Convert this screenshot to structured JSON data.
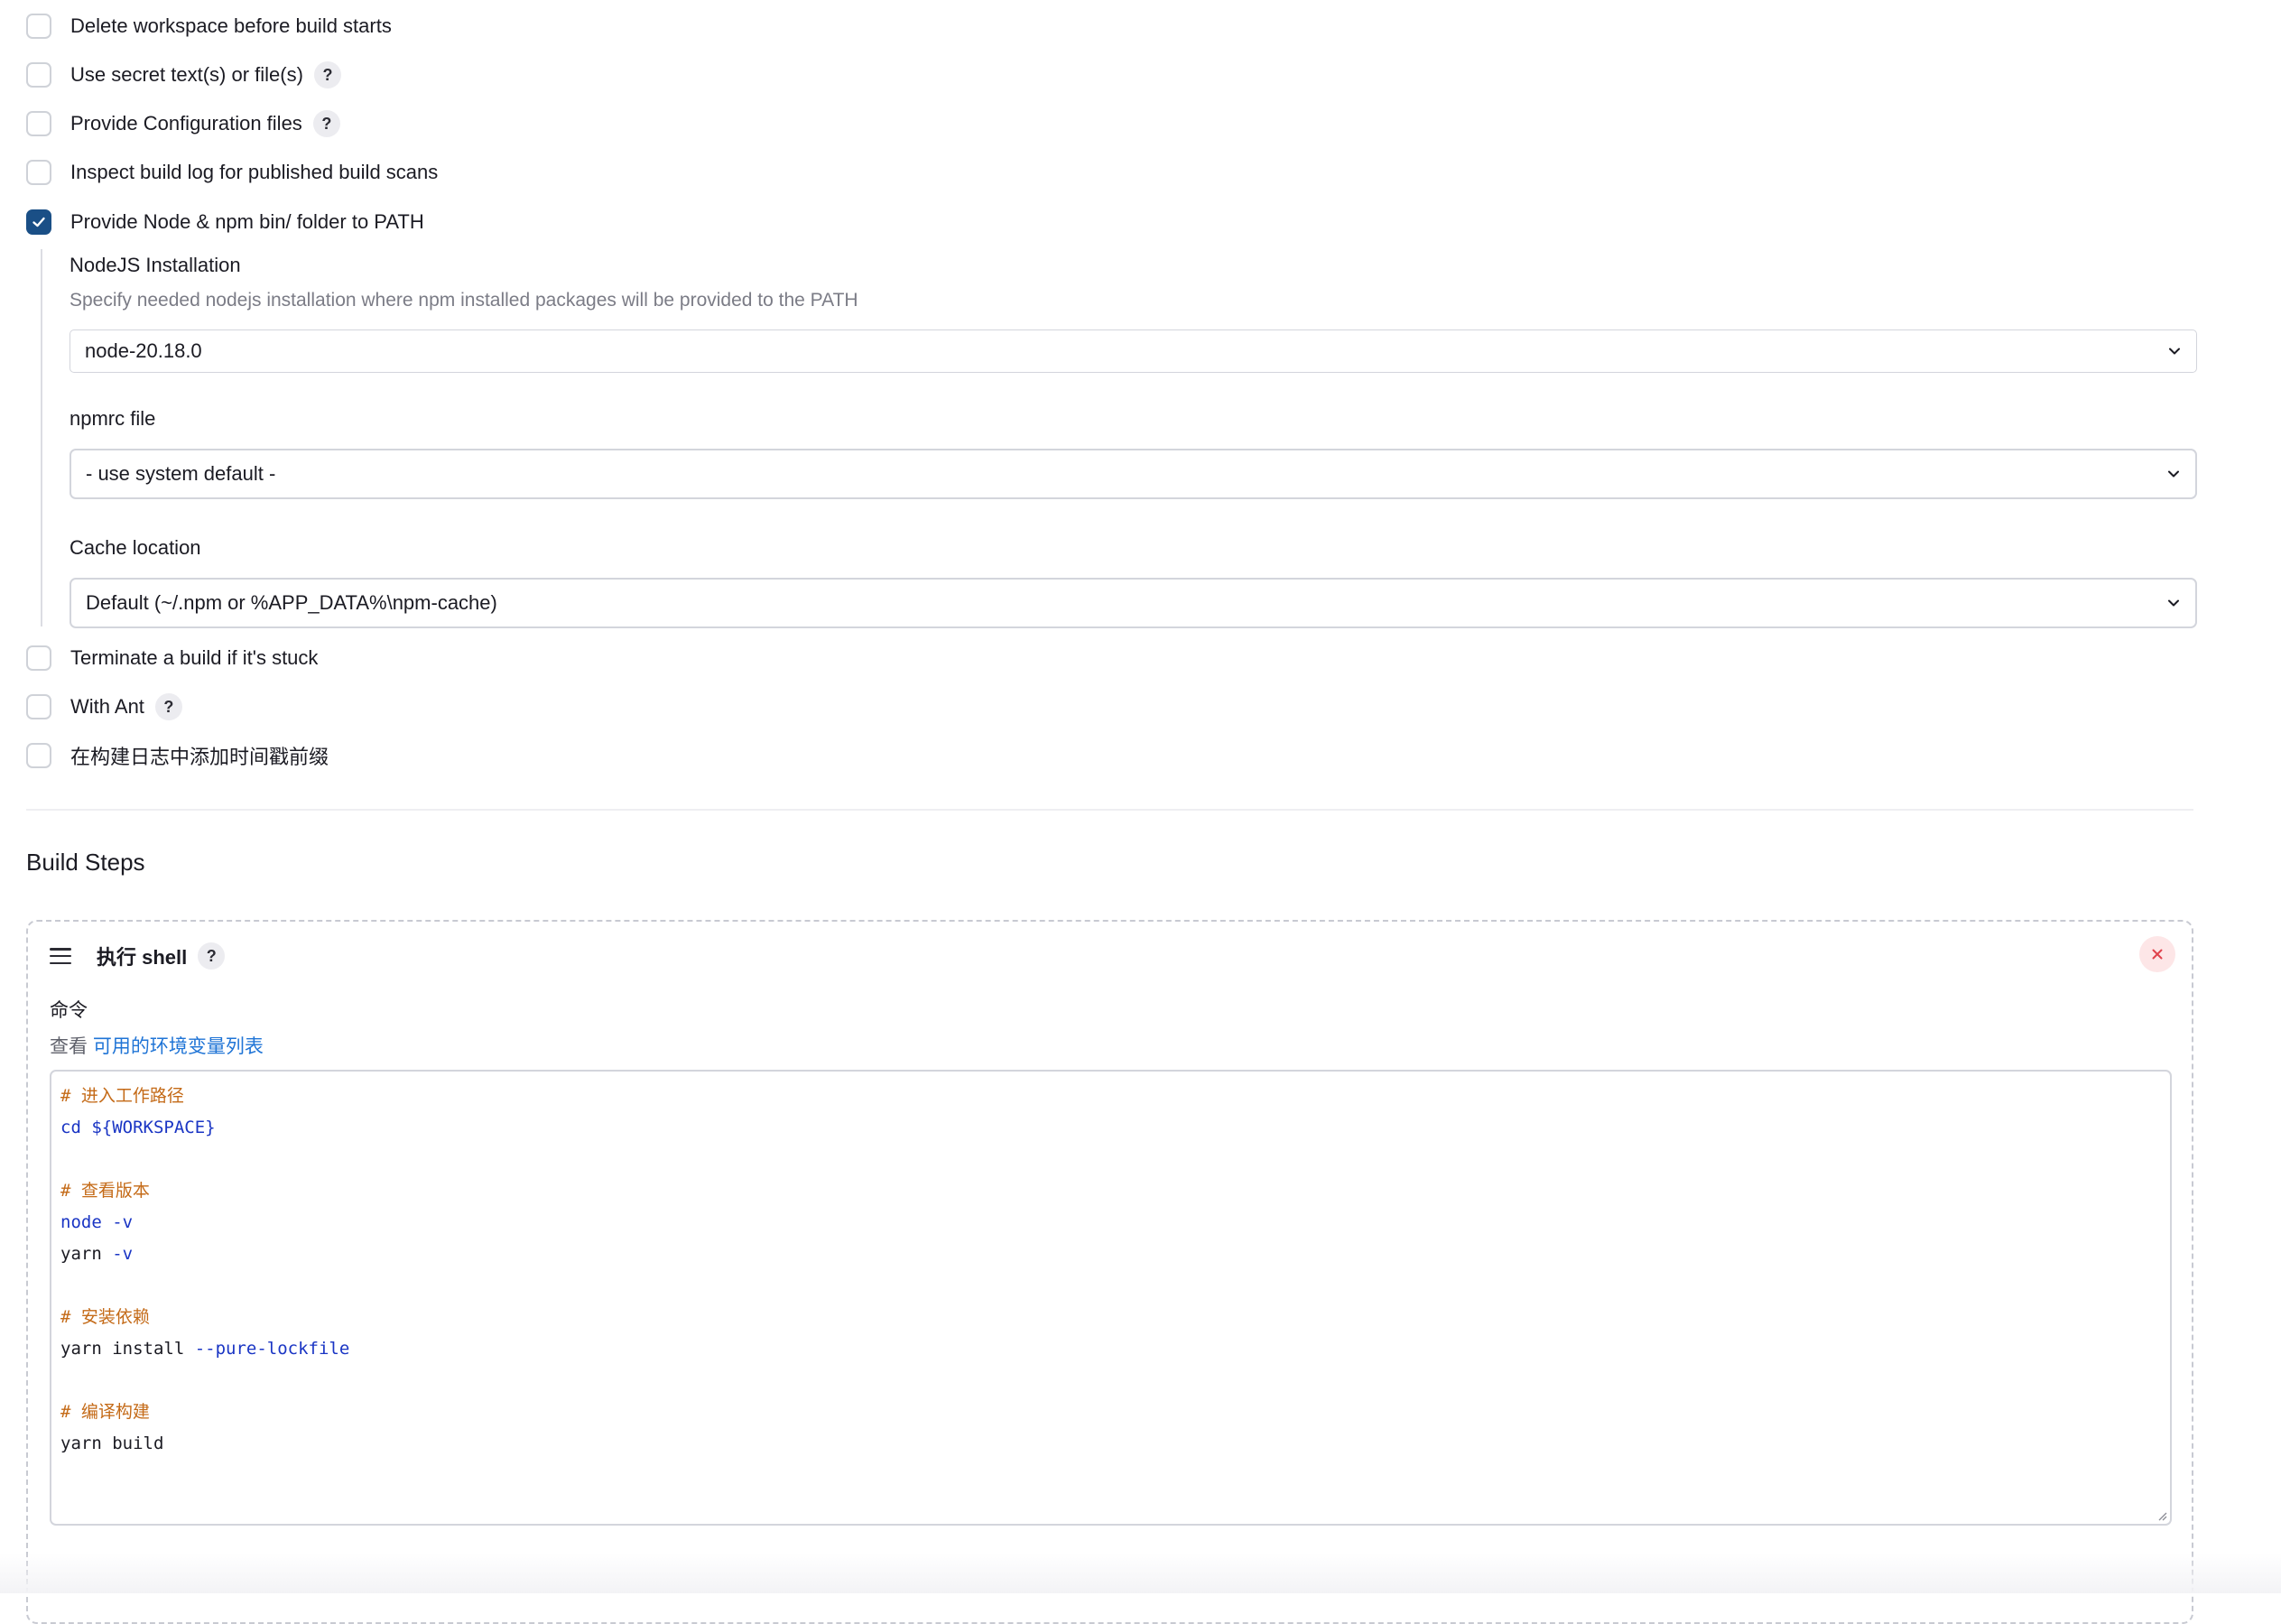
{
  "options_top": [
    {
      "label": "Delete workspace before build starts",
      "checked": false,
      "help": ""
    },
    {
      "label": "Use secret text(s) or file(s)",
      "checked": false,
      "help": "?"
    },
    {
      "label": "Provide Configuration files",
      "checked": false,
      "help": "?"
    },
    {
      "label": "Inspect build log for published build scans",
      "checked": false,
      "help": ""
    },
    {
      "label": "Provide Node & npm bin/ folder to PATH",
      "checked": true,
      "help": ""
    }
  ],
  "node": {
    "installation_label": "NodeJS Installation",
    "installation_desc": "Specify needed nodejs installation where npm installed packages will be provided to the PATH",
    "installation_value": "node-20.18.0",
    "npmrc_label": "npmrc file",
    "npmrc_value": "- use system default -",
    "cache_label": "Cache location",
    "cache_value": "Default (~/.npm or %APP_DATA%\\npm-cache)"
  },
  "options_bottom": [
    {
      "label": "Terminate a build if it's stuck",
      "checked": false,
      "help": ""
    },
    {
      "label": "With Ant",
      "checked": false,
      "help": "?"
    },
    {
      "label": "在构建日志中添加时间戳前缀",
      "checked": false,
      "help": ""
    }
  ],
  "build_steps": {
    "title": "Build Steps",
    "step": {
      "title": "执行 shell",
      "help": "?",
      "command_label": "命令",
      "env_prefix": "查看",
      "env_link": "可用的环境变量列表",
      "code_lines": [
        [
          {
            "t": "# 进入工作路径",
            "c": "comment"
          }
        ],
        [
          {
            "t": "cd ",
            "c": "kw"
          },
          {
            "t": "${WORKSPACE}",
            "c": "kw"
          }
        ],
        [],
        [
          {
            "t": "# 查看版本",
            "c": "comment"
          }
        ],
        [
          {
            "t": "node ",
            "c": "kw"
          },
          {
            "t": "-v",
            "c": "kw"
          }
        ],
        [
          {
            "t": "yarn ",
            "c": "plain"
          },
          {
            "t": "-v",
            "c": "kw"
          }
        ],
        [],
        [
          {
            "t": "# 安装依赖",
            "c": "comment"
          }
        ],
        [
          {
            "t": "yarn install ",
            "c": "plain"
          },
          {
            "t": "--pure-lockfile",
            "c": "kw"
          }
        ],
        [],
        [
          {
            "t": "# 编译构建",
            "c": "comment"
          }
        ],
        [
          {
            "t": "yarn build",
            "c": "plain"
          }
        ]
      ]
    }
  },
  "colors": {
    "checkbox_checked": "#1a4f86",
    "link": "#1f74d6",
    "comment": "#c46a17",
    "keyword": "#1a35c4",
    "close": "#e0424c"
  },
  "icons": {
    "check": "check-icon",
    "chevron": "chevron-down-icon",
    "drag": "drag-handle-icon",
    "close": "close-icon",
    "help": "help-icon"
  }
}
